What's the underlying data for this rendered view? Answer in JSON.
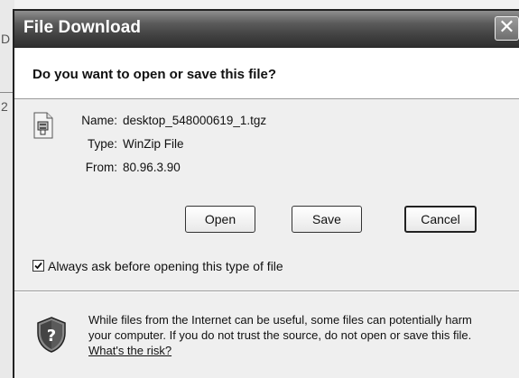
{
  "dialog": {
    "title": "File Download",
    "close_label": "✕"
  },
  "question": "Do you want to open or save this file?",
  "file_info": {
    "name_label": "Name:",
    "name_value": "desktop_548000619_1.tgz",
    "type_label": "Type:",
    "type_value": "WinZip File",
    "from_label": "From:",
    "from_value": "80.96.3.90"
  },
  "buttons": {
    "open": "Open",
    "save": "Save",
    "cancel": "Cancel"
  },
  "checkbox": {
    "checked": true,
    "label": "Always ask before opening this type of file"
  },
  "warning": {
    "text": "While files from the Internet can be useful, some files can potentially harm your computer. If you do not trust the source, do not open or save this file.",
    "link": "What's the risk?"
  },
  "background": {
    "chars": [
      "D",
      "2"
    ]
  },
  "icons": {
    "file": "winzip-file-icon",
    "shield": "security-shield-icon",
    "close": "close-icon",
    "check": "checkmark-icon"
  }
}
